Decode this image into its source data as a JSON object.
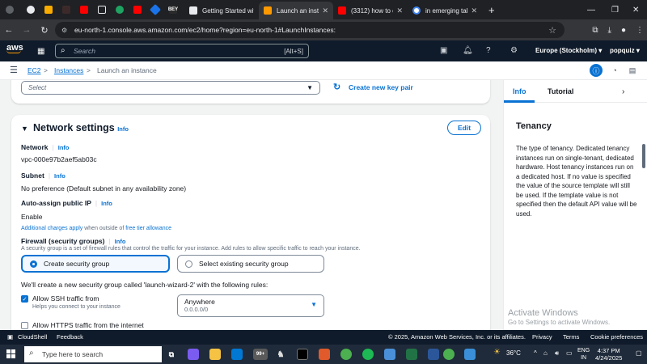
{
  "browser": {
    "tabs": [
      {
        "label": "Getting Started wit",
        "active": false
      },
      {
        "label": "Launch an instance",
        "active": true
      },
      {
        "label": "(3312) how to ens",
        "active": false
      },
      {
        "label": "in emerging talent",
        "active": false
      }
    ],
    "url": "eu-north-1.console.aws.amazon.com/ec2/home?region=eu-north-1#LaunchInstances:",
    "mini_tab_texts": [
      "",
      "",
      "",
      "",
      "",
      "",
      "",
      "",
      "",
      "",
      "",
      "",
      "BEY",
      ""
    ]
  },
  "aws_nav": {
    "logo": "aws",
    "search_placeholder": "Search",
    "search_shortcut": "[Alt+S]",
    "region": "Europe (Stockholm) ▾",
    "user": "popquiz ▾"
  },
  "breadcrumb": {
    "items": [
      "EC2",
      "Instances",
      "Launch an instance"
    ],
    "separator": ">"
  },
  "key_pair": {
    "select_placeholder": "Select",
    "create_link": "Create new key pair"
  },
  "network": {
    "title": "Network settings",
    "info": "Info",
    "edit": "Edit",
    "network_label": "Network",
    "network_value": "vpc-000e97b2aef5ab03c",
    "subnet_label": "Subnet",
    "subnet_value": "No preference (Default subnet in any availability zone)",
    "public_ip_label": "Auto-assign public IP",
    "public_ip_value": "Enable",
    "charges_link": "Additional charges apply",
    "charges_mid": " when outside of ",
    "charges_link2": "free tier allowance",
    "firewall_label": "Firewall (security groups)",
    "firewall_desc": "A security group is a set of firewall rules that control the traffic for your instance. Add rules to allow specific traffic to reach your instance.",
    "option_create": "Create security group",
    "option_existing": "Select existing security group",
    "new_group_text": "We'll create a new security group called 'launch-wizard-2' with the following rules:",
    "ssh_label": "Allow SSH traffic from",
    "ssh_desc": "Helps you connect to your instance",
    "ssh_checked": true,
    "ssh_source": "Anywhere",
    "ssh_source_cidr": "0.0.0.0/0",
    "https_label": "Allow HTTPS traffic from the internet",
    "https_checked": false
  },
  "help_panel": {
    "tab_info": "Info",
    "tab_tutorial": "Tutorial",
    "heading": "Tenancy",
    "body": "The type of tenancy. Dedicated tenancy instances run on single-tenant, dedicated hardware. Host tenancy instances run on a dedicated host. If no value is specified the value of the source template will still be used. If the template value is not specified then the default API value will be used."
  },
  "watermark": {
    "line1": "Activate Windows",
    "line2": "Go to Settings to activate Windows."
  },
  "footer": {
    "cloudshell": "CloudShell",
    "feedback": "Feedback",
    "copyright": "© 2025, Amazon Web Services, Inc. or its affiliates.",
    "privacy": "Privacy",
    "terms": "Terms",
    "cookies": "Cookie preferences"
  },
  "taskbar": {
    "search_placeholder": "Type here to search",
    "temperature": "36°C",
    "lang1": "ENG",
    "lang2": "IN",
    "time": "4:37 PM",
    "date": "4/24/2025",
    "badge": "99+"
  },
  "colors": {
    "aws_nav_bg": "#0f1b2a",
    "link_blue": "#0972d3",
    "aws_orange": "#ff9900"
  }
}
